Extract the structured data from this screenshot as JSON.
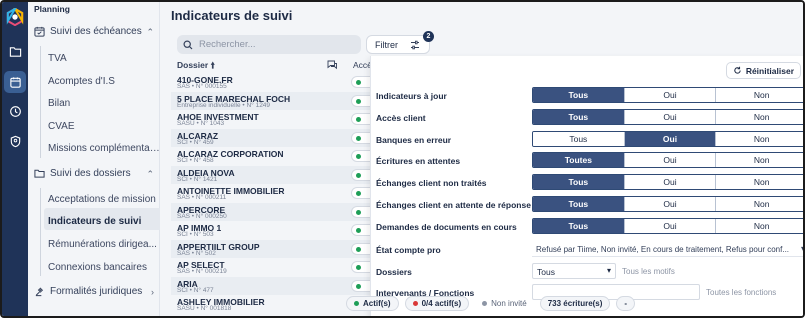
{
  "colors": {
    "rail": "#1f3358",
    "accent": "#3a5280",
    "green": "#1e9e57",
    "red": "#d93838",
    "grey": "#8d95a5"
  },
  "sidebar": {
    "top_title": "Planning",
    "groups": [
      {
        "label": "Suivi des échéances",
        "icon": "calendar-check-icon"
      },
      {
        "label": "Suivi des dossiers",
        "icon": "folder-icon"
      },
      {
        "label": "Formalités juridiques",
        "icon": "gavel-icon"
      }
    ],
    "echeances_items": [
      "TVA",
      "Acomptes d'I.S",
      "Bilan",
      "CVAE",
      "Missions complémentai..."
    ],
    "dossiers_items": [
      "Acceptations de mission",
      "Indicateurs de suivi",
      "Rémunérations dirigea...",
      "Connexions bancaires"
    ],
    "active_item": "Indicateurs de suivi"
  },
  "main": {
    "title": "Indicateurs de suivi",
    "search_placeholder": "Rechercher...",
    "filter_label": "Filtrer",
    "filter_badge": "2",
    "columns": {
      "dossier": "Dossier",
      "acces": "Accè"
    },
    "rows": [
      {
        "name": "410-GONE.FR",
        "sub": "SAS • N° 000155"
      },
      {
        "name": "5 PLACE MARECHAL FOCH",
        "sub": "Entreprise individuelle • N° 1249"
      },
      {
        "name": "AHOE INVESTMENT",
        "sub": "SASU • N° 1043"
      },
      {
        "name": "ALCARAZ",
        "sub": "SCI • N° 459"
      },
      {
        "name": "ALCARAZ CORPORATION",
        "sub": "SCI • N° 458"
      },
      {
        "name": "ALDEIA NOVA",
        "sub": "SCI • N° 1421"
      },
      {
        "name": "ANTOINETTE IMMOBILIER",
        "sub": "SAS • N° 000211"
      },
      {
        "name": "APERCORE",
        "sub": "SAS • N° 000250"
      },
      {
        "name": "AP IMMO 1",
        "sub": "SCI • N° 503"
      },
      {
        "name": "APPERTIILT GROUP",
        "sub": "SAS • N° 502"
      },
      {
        "name": "AP SELECT",
        "sub": "SAS • N° 000219"
      },
      {
        "name": "ARIA",
        "sub": "SCI • N° 477"
      },
      {
        "name": "ASHLEY IMMOBILIER",
        "sub": "SASU • N° 001818"
      }
    ]
  },
  "panel": {
    "reset_label": "Réinitialiser",
    "filters": [
      {
        "label": "Indicateurs à jour",
        "options": [
          "Tous",
          "Oui",
          "Non"
        ],
        "selected": 0
      },
      {
        "label": "Accès client",
        "options": [
          "Tous",
          "Oui",
          "Non"
        ],
        "selected": 0
      },
      {
        "label": "Banques en erreur",
        "options": [
          "Tous",
          "Oui",
          "Non"
        ],
        "selected": 1
      },
      {
        "label": "Écritures en attentes",
        "options": [
          "Toutes",
          "Oui",
          "Non"
        ],
        "selected": 0
      },
      {
        "label": "Échanges client non traités",
        "options": [
          "Tous",
          "Oui",
          "Non"
        ],
        "selected": 0
      },
      {
        "label": "Échanges client en attente de réponse",
        "options": [
          "Tous",
          "Oui",
          "Non"
        ],
        "selected": 0
      },
      {
        "label": "Demandes de documents en cours",
        "options": [
          "Tous",
          "Oui",
          "Non"
        ],
        "selected": 0
      }
    ],
    "etat_compte_label": "État compte pro",
    "etat_compte_value": "Refusé par Tiime, Non invité, En cours de traitement, Refus pour conf...",
    "dossiers_label": "Dossiers",
    "dossiers_value": "Tous",
    "dossiers_motifs_placeholder": "Tous les motifs",
    "intervenants_label": "Intervenants / Fonctions",
    "intervenants_fonctions_placeholder": "Toutes les fonctions"
  },
  "status_bar": {
    "actifs": "Actif(s)",
    "actifs_count": "0/4 actif(s)",
    "non_invite": "Non invité",
    "ecritures": "733 écriture(s)",
    "dash": "-"
  }
}
